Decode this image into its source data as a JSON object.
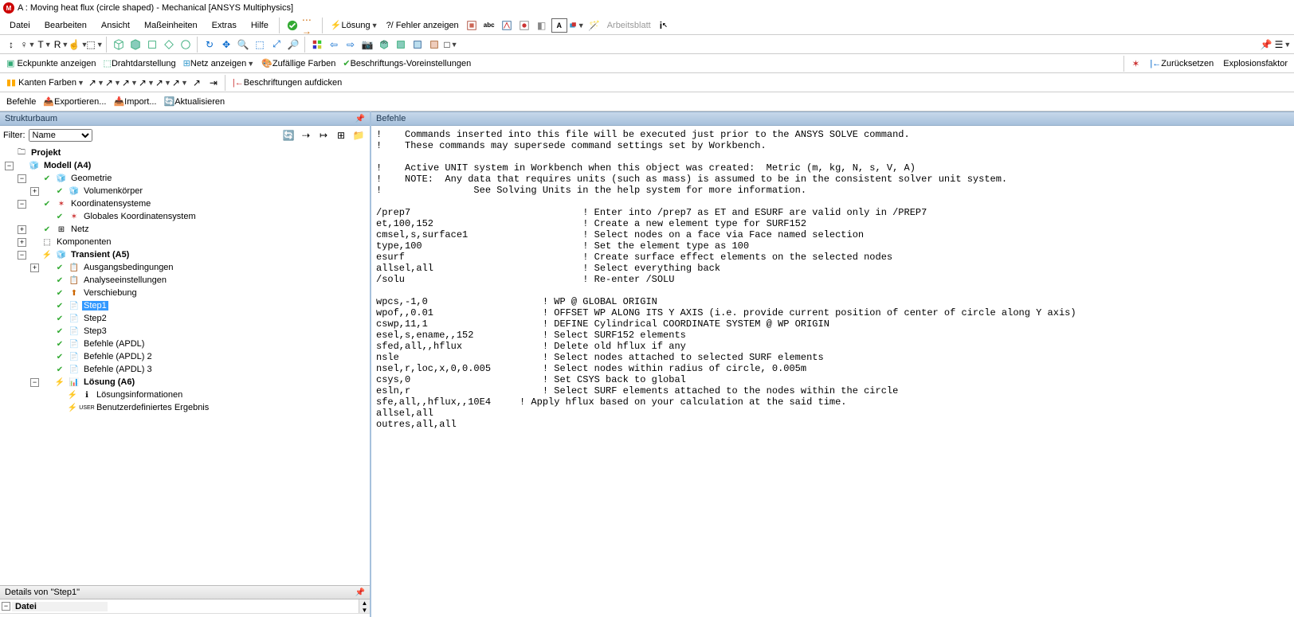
{
  "title": "A : Moving heat flux (circle shaped) - Mechanical [ANSYS Multiphysics]",
  "menu": [
    "Datei",
    "Bearbeiten",
    "Ansicht",
    "Maßeinheiten",
    "Extras",
    "Hilfe"
  ],
  "tb1": {
    "losung": "Lösung",
    "fehler": "?/ Fehler anzeigen",
    "arbeitsblatt": "Arbeitsblatt"
  },
  "tb3": {
    "eckpunkte": "Eckpunkte anzeigen",
    "draht": "Drahtdarstellung",
    "netz": "Netz anzeigen",
    "zufall": "Zufällige Farben",
    "beschrift": "Beschriftungs-Voreinstellungen",
    "zuruck": "Zurücksetzen",
    "explosion": "Explosionsfaktor"
  },
  "tb4": {
    "kanten": "Kanten Farben",
    "beschrift_auf": "Beschriftungen aufdicken"
  },
  "tb5": {
    "befehle": "Befehle",
    "export": "Exportieren...",
    "import": "Import...",
    "aktual": "Aktualisieren"
  },
  "left": {
    "hdr": "Strukturbaum",
    "filter_lbl": "Filter:",
    "filter_val": "Name",
    "projekt": "Projekt",
    "modell": "Modell (A4)",
    "geometrie": "Geometrie",
    "volumen": "Volumenkörper",
    "koord": "Koordinatensysteme",
    "glob_koord": "Globales Koordinatensystem",
    "netz": "Netz",
    "komponenten": "Komponenten",
    "transient": "Transient (A5)",
    "ausgangs": "Ausgangsbedingungen",
    "analyse": "Analyseeinstellungen",
    "verschiebung": "Verschiebung",
    "step1": "Step1",
    "step2": "Step2",
    "step3": "Step3",
    "befehle1": "Befehle (APDL)",
    "befehle2": "Befehle (APDL) 2",
    "befehle3": "Befehle (APDL) 3",
    "losung6": "Lösung (A6)",
    "losungsinfo": "Lösungsinformationen",
    "benutzer": "Benutzerdefiniertes Ergebnis"
  },
  "details": {
    "hdr": "Details von \"Step1\"",
    "datei": "Datei"
  },
  "right": {
    "hdr": "Befehle",
    "code": "!    Commands inserted into this file will be executed just prior to the ANSYS SOLVE command.\n!    These commands may supersede command settings set by Workbench.\n\n!    Active UNIT system in Workbench when this object was created:  Metric (m, kg, N, s, V, A)\n!    NOTE:  Any data that requires units (such as mass) is assumed to be in the consistent solver unit system.\n!                See Solving Units in the help system for more information.\n\n/prep7                              ! Enter into /prep7 as ET and ESURF are valid only in /PREP7\net,100,152                          ! Create a new element type for SURF152\ncmsel,s,surface1                    ! Select nodes on a face via Face named selection\ntype,100                            ! Set the element type as 100\nesurf                               ! Create surface effect elements on the selected nodes\nallsel,all                          ! Select everything back\n/solu                               ! Re-enter /SOLU\n\nwpcs,-1,0                    ! WP @ GLOBAL ORIGIN\nwpof,,0.01                   ! OFFSET WP ALONG ITS Y AXIS (i.e. provide current position of center of circle along Y axis)\ncswp,11,1                    ! DEFINE Cylindrical COORDINATE SYSTEM @ WP ORIGIN\nesel,s,ename,,152            ! Select SURF152 elements\nsfed,all,,hflux              ! Delete old hflux if any\nnsle                         ! Select nodes attached to selected SURF elements\nnsel,r,loc,x,0,0.005         ! Select nodes within radius of circle, 0.005m\ncsys,0                       ! Set CSYS back to global\nesln,r                       ! Select SURF elements attached to the nodes within the circle\nsfe,all,,hflux,,10E4     ! Apply hflux based on your calculation at the said time.\nallsel,all\noutres,all,all"
  }
}
